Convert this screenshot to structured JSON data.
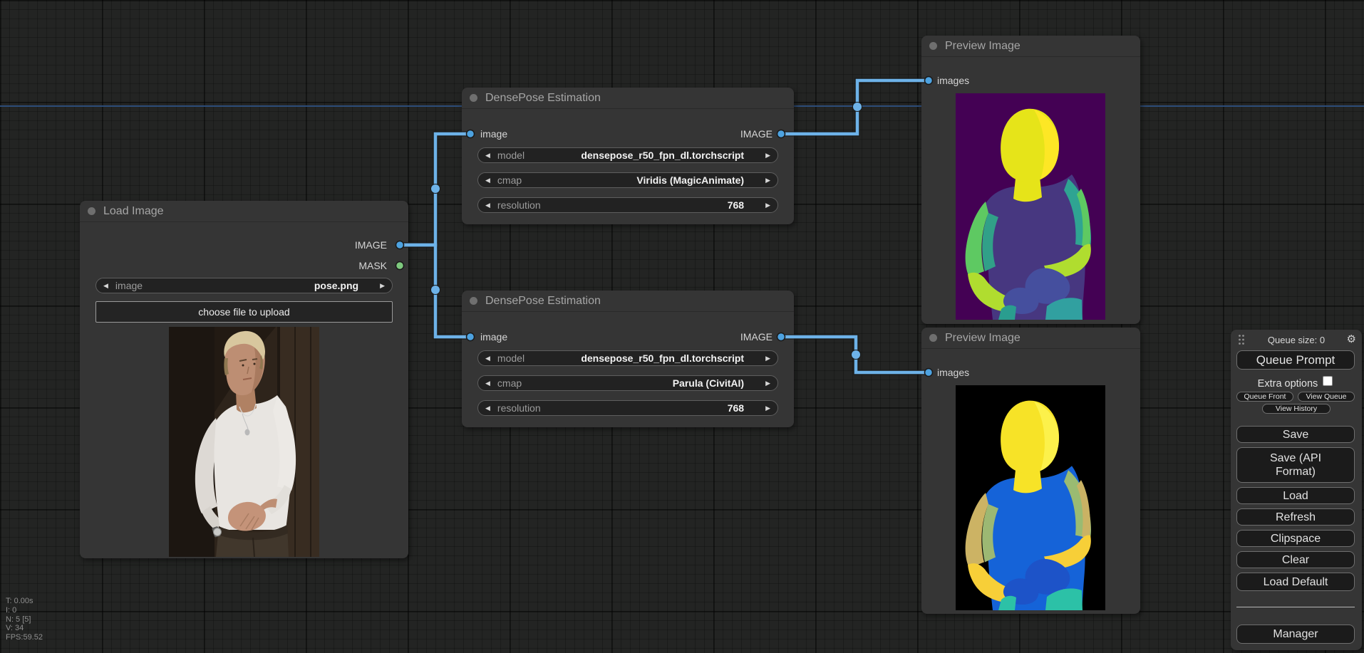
{
  "stats": {
    "lines": [
      "T: 0.00s",
      "I: 0",
      "N: 5 [5]",
      "V: 34",
      "FPS:59.52"
    ]
  },
  "icons": {
    "arrow_left": "◀",
    "arrow_right": "▶",
    "gear": "⚙"
  },
  "nodes": {
    "load_image": {
      "title": "Load Image",
      "output1": "IMAGE",
      "output2": "MASK",
      "widget_image": {
        "label": "image",
        "value": "pose.png"
      },
      "upload_label": "choose file to upload"
    },
    "densepose1": {
      "title": "DensePose Estimation",
      "input": "image",
      "output": "IMAGE",
      "widgets": [
        {
          "label": "model",
          "value": "densepose_r50_fpn_dl.torchscript"
        },
        {
          "label": "cmap",
          "value": "Viridis (MagicAnimate)"
        },
        {
          "label": "resolution",
          "value": "768"
        }
      ]
    },
    "densepose2": {
      "title": "DensePose Estimation",
      "input": "image",
      "output": "IMAGE",
      "widgets": [
        {
          "label": "model",
          "value": "densepose_r50_fpn_dl.torchscript"
        },
        {
          "label": "cmap",
          "value": "Parula (CivitAI)"
        },
        {
          "label": "resolution",
          "value": "768"
        }
      ]
    },
    "preview1": {
      "title": "Preview Image",
      "input": "images"
    },
    "preview2": {
      "title": "Preview Image",
      "input": "images"
    }
  },
  "menu": {
    "queue_size": "Queue size: 0",
    "queue_prompt": "Queue Prompt",
    "extra_options": "Extra options",
    "queue_front": "Queue Front",
    "view_queue": "View Queue",
    "view_history": "View History",
    "save": "Save",
    "save_api": "Save (API Format)",
    "load": "Load",
    "refresh": "Refresh",
    "clipspace": "Clipspace",
    "clear": "Clear",
    "load_default": "Load Default",
    "manager": "Manager"
  },
  "colors": {
    "link": "#6db2e8",
    "slot_image": "#4da2e0",
    "slot_mask": "#7ec97e",
    "viridis": {
      "bg": "#440154",
      "torso": "#473780",
      "hand": "#454f9e",
      "arm_outer": "#5ec962",
      "arm_inner": "#31a088",
      "arm_right": "#2fa492",
      "arm_right_edge": "#5ec962",
      "forearm": "#b0dd2f",
      "neck": "#e6e419",
      "head": "#e6e419",
      "head_hi": "#fde725",
      "bottom_right": "#31a0a0",
      "bottom_left": "#2a9d8f"
    },
    "parula": {
      "bg": "#000000",
      "torso": "#1563d8",
      "hand": "#1d53c8",
      "arm_outer": "#ccb364",
      "arm_inner": "#9cb873",
      "arm_right": "#9abb72",
      "arm_right_edge": "#cab264",
      "forearm": "#f7cf38",
      "neck": "#f7e327",
      "head": "#f7e327",
      "head_hi": "#fcf14b",
      "bottom_right": "#2cc1a7",
      "bottom_left": "#2cc1a7"
    }
  }
}
